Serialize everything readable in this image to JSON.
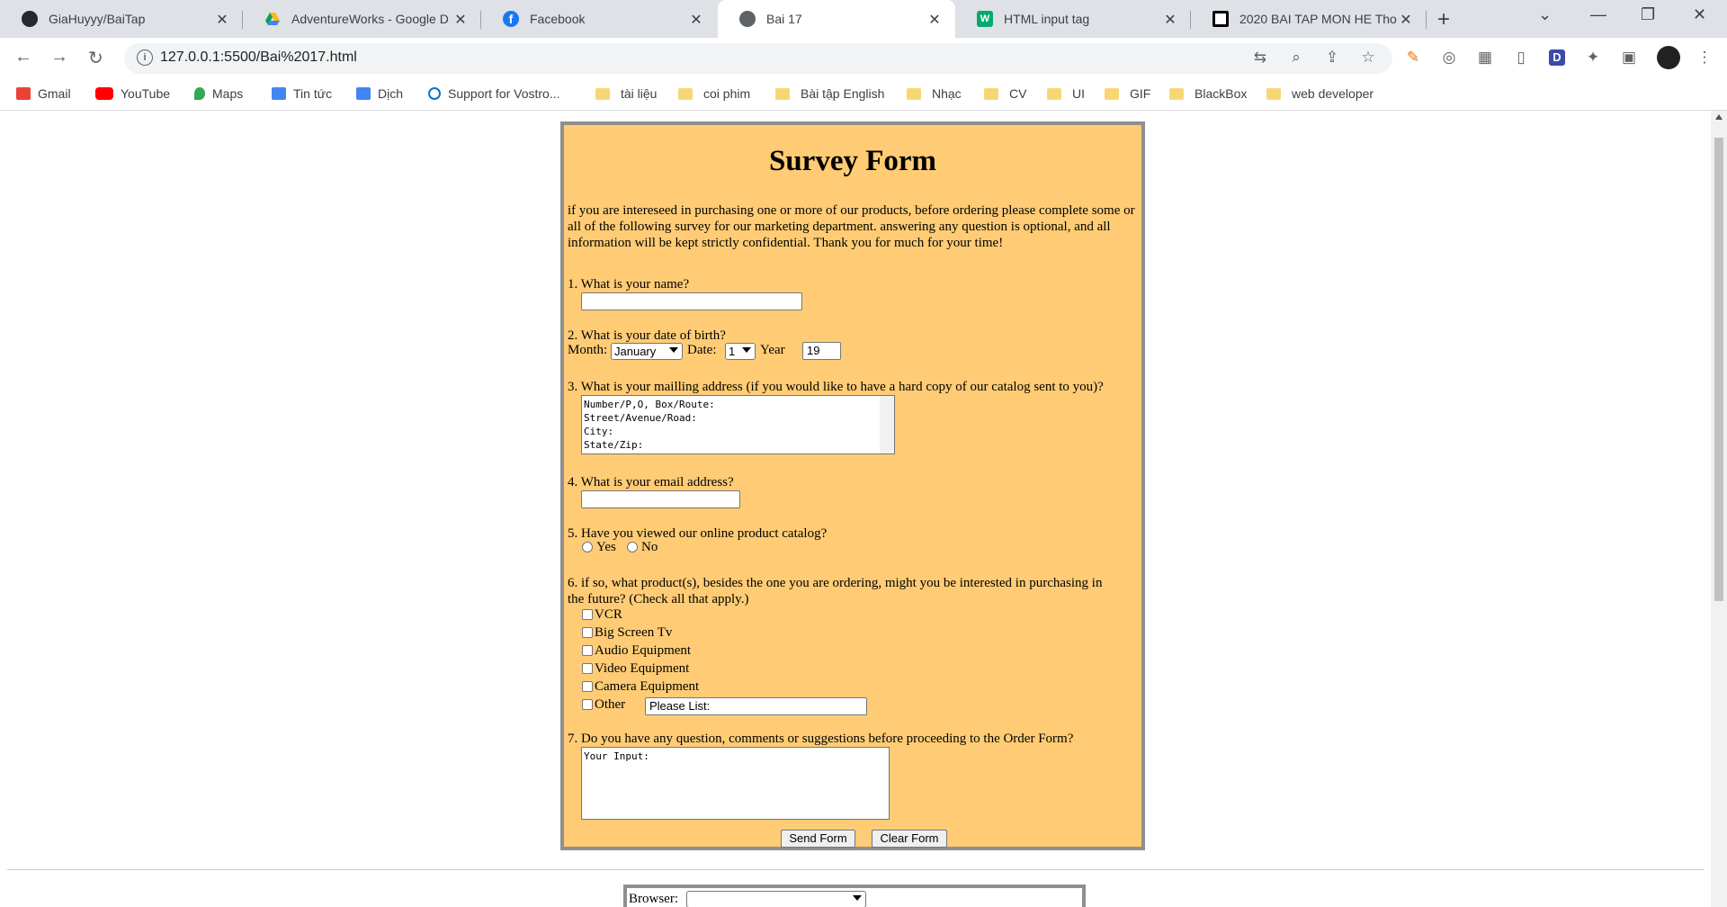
{
  "tabs": [
    {
      "title": "GiaHuyyy/BaiTap",
      "icon": "github-icon"
    },
    {
      "title": "AdventureWorks - Google D",
      "icon": "google-drive-icon"
    },
    {
      "title": "Facebook",
      "icon": "facebook-icon"
    },
    {
      "title": "Bai 17",
      "icon": "globe-icon"
    },
    {
      "title": "HTML input tag",
      "icon": "w3schools-icon"
    },
    {
      "title": "2020 BAI TAP MON HE Tho",
      "icon": "square-logo-icon"
    }
  ],
  "address_bar": {
    "url": "127.0.0.1:5500/Bai%2017.html"
  },
  "bookmarks": [
    {
      "label": "Gmail",
      "color": "#ea4335"
    },
    {
      "label": "YouTube",
      "color": "#ff0000"
    },
    {
      "label": "Maps",
      "color": "#34a853"
    },
    {
      "label": "Tin tức",
      "color": "#4285f4"
    },
    {
      "label": "Dịch",
      "color": "#4285f4"
    },
    {
      "label": "Support for Vostro...",
      "color": "#0076ce"
    },
    {
      "label": "tài liệu",
      "color": "#f7d774"
    },
    {
      "label": "coi phim",
      "color": "#f7d774"
    },
    {
      "label": "Bài tập English",
      "color": "#f7d774"
    },
    {
      "label": "Nhạc",
      "color": "#f7d774"
    },
    {
      "label": "CV",
      "color": "#f7d774"
    },
    {
      "label": "UI",
      "color": "#f7d774"
    },
    {
      "label": "GIF",
      "color": "#f7d774"
    },
    {
      "label": "BlackBox",
      "color": "#f7d774"
    },
    {
      "label": "web developer",
      "color": "#f7d774"
    }
  ],
  "form": {
    "title": "Survey Form",
    "intro": "if you are intereseed in purchasing one or more of our products, before ordering please complete some or all of the following survey for our marketing department. answering any question is optional, and all information will be kept strictly confidential. Thank you for much for your time!",
    "q1": "1. What is your name?",
    "q2": "2. What is your date of birth?",
    "month_label": "Month:",
    "month_value": "January",
    "date_label": "Date:",
    "date_value": "1",
    "year_label": "Year",
    "year_value": "19",
    "q3": "3. What is your mailling address (if you would like to have a hard copy of our catalog sent to you)?",
    "address_text": "Number/P,O, Box/Route:\nStreet/Avenue/Road:\nCity:\nState/Zip:",
    "q4": "4. What is your email address?",
    "q5": "5. Have you viewed our online product catalog?",
    "yes_label": "Yes",
    "no_label": "No",
    "q6_line1": "6. if so, what product(s), besides the one you are ordering, might you be interested in purchasing in",
    "q6_line2": "the future? (Check all that apply.)",
    "products": [
      "VCR",
      "Big Screen Tv",
      "Audio Equipment",
      "Video Equipment",
      "Camera Equipment",
      "Other"
    ],
    "other_value": "Please List:",
    "q7": "7. Do you have any question, comments or suggestions before proceeding to the Order Form?",
    "comments_value": "Your Input:",
    "send_label": "Send Form",
    "clear_label": "Clear Form"
  },
  "second_form": {
    "browser_label": "Browser:"
  }
}
